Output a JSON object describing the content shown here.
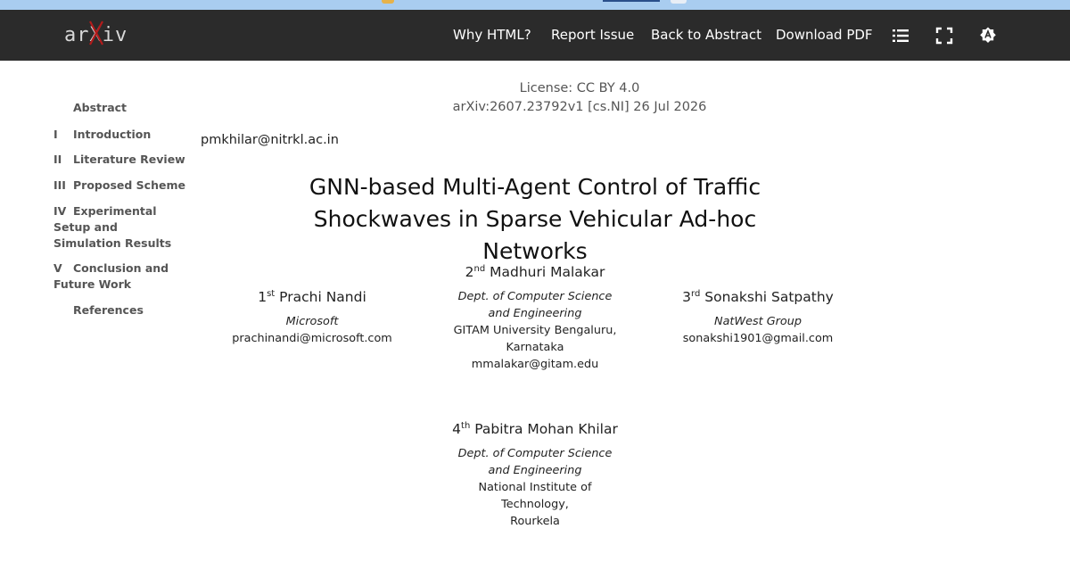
{
  "navbar": {
    "logo": "arXiv",
    "links": [
      "Why HTML?",
      "Report Issue",
      "Back to Abstract",
      "Download PDF"
    ],
    "icons": [
      "list-icon",
      "fullscreen-icon",
      "theme-icon"
    ],
    "bg_color": "#2b2b2b",
    "logo_x_color": "#b31b1b"
  },
  "toc": {
    "items": [
      {
        "num": "",
        "label": "Abstract"
      },
      {
        "num": "I",
        "label": "Introduction"
      },
      {
        "num": "II",
        "label": "Literature Review"
      },
      {
        "num": "III",
        "label": "Proposed Scheme"
      },
      {
        "num": "IV",
        "label": "Experimental Setup and Simulation Results"
      },
      {
        "num": "V",
        "label": "Conclusion and Future Work"
      },
      {
        "num": "",
        "label": "References"
      }
    ]
  },
  "paper": {
    "license": "License: CC BY 4.0",
    "arxiv_id": "arXiv:2607.23792v1 [cs.NI] 26 Jul 2026",
    "email_top": "pmkhilar@nitrkl.ac.in",
    "title_line1": "GNN-based Multi-Agent Control of Traffic",
    "title_line2": "Shockwaves in Sparse Vehicular Ad-hoc Networks",
    "authors": [
      {
        "ordinal": "1",
        "suffix": "st",
        "name": "Prachi Nandi",
        "affiliation": "Microsoft",
        "lines": [],
        "email": "prachinandi@microsoft.com"
      },
      {
        "ordinal": "2",
        "suffix": "nd",
        "name": "Madhuri Malakar",
        "affiliation": "Dept. of Computer Science and Engineering",
        "lines": [
          "GITAM University Bengaluru,",
          "Karnataka"
        ],
        "email": "mmalakar@gitam.edu"
      },
      {
        "ordinal": "3",
        "suffix": "rd",
        "name": "Sonakshi Satpathy",
        "affiliation": "NatWest Group",
        "lines": [],
        "email": "sonakshi1901@gmail.com"
      },
      {
        "ordinal": "4",
        "suffix": "th",
        "name": "Pabitra Mohan Khilar",
        "affiliation": "Dept. of Computer Science and Engineering",
        "lines": [
          "National Institute of Technology,",
          "Rourkela"
        ],
        "email": ""
      }
    ]
  }
}
